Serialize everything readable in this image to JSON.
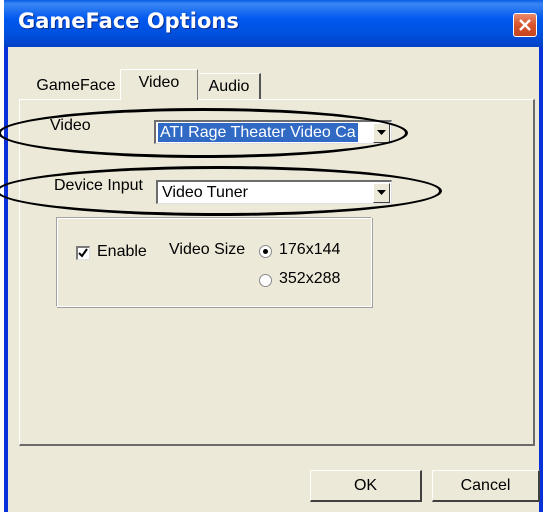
{
  "window": {
    "title": "GameFace Options"
  },
  "tabs": [
    {
      "label": "GameFace",
      "active": false
    },
    {
      "label": "Video",
      "active": true
    },
    {
      "label": "Audio",
      "active": false
    }
  ],
  "video_panel": {
    "video_label": "Video",
    "video_value": "ATI Rage Theater Video Ca",
    "device_input_label": "Device Input",
    "device_input_value": "Video Tuner",
    "enable_label": "Enable",
    "enable_checked": true,
    "video_size_label": "Video Size",
    "size_options": [
      {
        "label": "176x144",
        "selected": true
      },
      {
        "label": "352x288",
        "selected": false
      }
    ]
  },
  "buttons": {
    "ok_label": "OK",
    "cancel_label": "Cancel"
  },
  "colors": {
    "titlebar": "#0058ee",
    "window_bg": "#ece9d8",
    "selection": "#316ac5",
    "close_button": "#d9542b"
  }
}
